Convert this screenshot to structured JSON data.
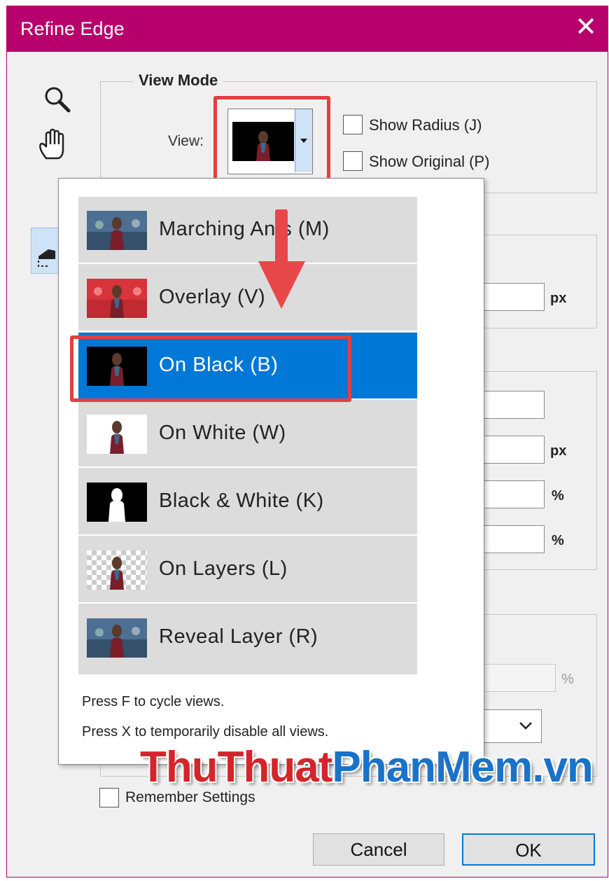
{
  "window": {
    "title": "Refine Edge",
    "close_icon": "close-icon"
  },
  "tools": [
    "zoom-tool-icon",
    "hand-tool-icon",
    "refine-radius-tool-icon"
  ],
  "view_mode": {
    "legend": "View Mode",
    "view_label": "View:",
    "show_radius_label": "Show Radius (J)",
    "show_original_label": "Show Original (P)"
  },
  "units": {
    "px1": "px",
    "px2": "px",
    "pct1": "%",
    "pct2": "%",
    "pct3": "%"
  },
  "menu": {
    "items": [
      {
        "label": "Marching Ants (M)",
        "thumb": "photo"
      },
      {
        "label": "Overlay (V)",
        "thumb": "red-overlay"
      },
      {
        "label": "On Black (B)",
        "thumb": "black",
        "selected": true
      },
      {
        "label": "On White (W)",
        "thumb": "white"
      },
      {
        "label": "Black & White (K)",
        "thumb": "mask"
      },
      {
        "label": "On Layers (L)",
        "thumb": "checker"
      },
      {
        "label": "Reveal Layer (R)",
        "thumb": "photo"
      }
    ],
    "hint1": "Press F to cycle views.",
    "hint2": "Press X to temporarily disable all views."
  },
  "remember_settings_label": "Remember Settings",
  "buttons": {
    "cancel": "Cancel",
    "ok": "OK"
  },
  "watermark": {
    "part1": "ThuThuat",
    "part2": "PhanMem",
    "part3": ".vn"
  },
  "colors": {
    "titlebar": "#b8006c",
    "selection": "#0078d7",
    "highlight": "#e33f3f",
    "watermark_red": "#d4252b",
    "watermark_blue": "#1a73c9"
  }
}
